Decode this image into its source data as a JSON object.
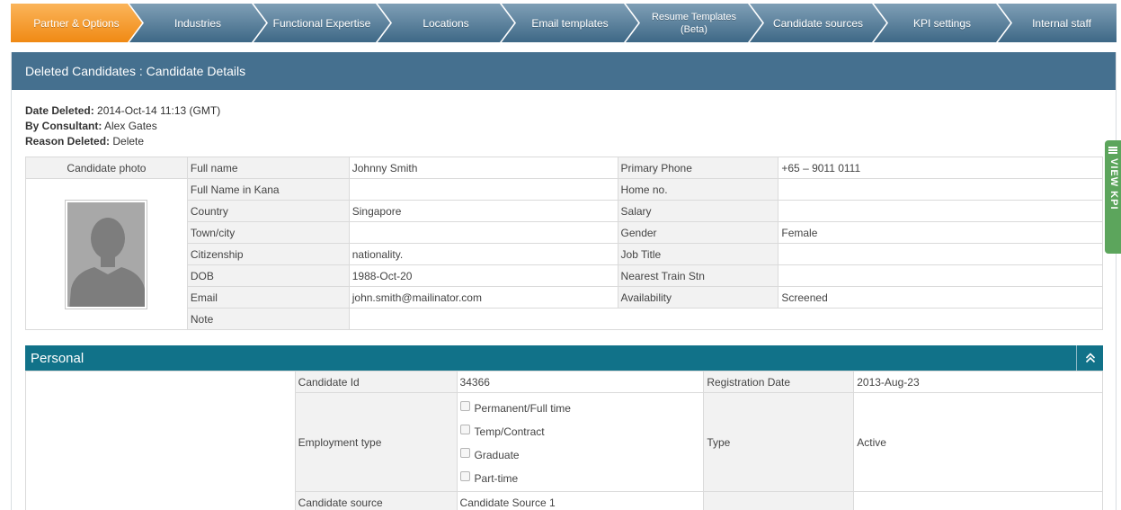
{
  "tabs": [
    {
      "label": "Partner & Options",
      "active": true
    },
    {
      "label": "Industries",
      "active": false
    },
    {
      "label": "Functional Expertise",
      "active": false
    },
    {
      "label": "Locations",
      "active": false
    },
    {
      "label": "Email templates",
      "active": false
    },
    {
      "label": "Resume Templates (Beta)",
      "line1": "Resume Templates",
      "line2": "(Beta)",
      "active": false
    },
    {
      "label": "Candidate sources",
      "active": false
    },
    {
      "label": "KPI settings",
      "active": false
    },
    {
      "label": "Internal staff",
      "active": false
    }
  ],
  "colors": {
    "active_tab": "#f7941e",
    "inactive_tab": "#4e7795",
    "panel_header": "#45708f",
    "section_bar": "#117289",
    "kpi_tab": "#5ca55c"
  },
  "page_title": "Deleted Candidates : Candidate Details",
  "meta": {
    "date_deleted_label": "Date Deleted:",
    "date_deleted_value": "2014-Oct-14 11:13 (GMT)",
    "consultant_label": "By Consultant:",
    "consultant_value": "Alex Gates",
    "reason_label": "Reason Deleted:",
    "reason_value": "Delete"
  },
  "details": {
    "photo_label": "Candidate photo",
    "rows": [
      {
        "l1": "Full name",
        "v1": "Johnny Smith",
        "l2": "Primary Phone",
        "v2": "+65 – 9011 0111"
      },
      {
        "l1": "Full Name in Kana",
        "v1": "",
        "l2": "Home no.",
        "v2": ""
      },
      {
        "l1": "Country",
        "v1": "Singapore",
        "l2": "Salary",
        "v2": ""
      },
      {
        "l1": "Town/city",
        "v1": "",
        "l2": "Gender",
        "v2": "Female"
      },
      {
        "l1": "Citizenship",
        "v1": "nationality.",
        "l2": "Job Title",
        "v2": ""
      },
      {
        "l1": "DOB",
        "v1": "1988-Oct-20",
        "l2": "Nearest Train Stn",
        "v2": ""
      },
      {
        "l1": "Email",
        "v1": "john.smith@mailinator.com",
        "l2": "Availability",
        "v2": "Screened"
      }
    ],
    "note_label": "Note",
    "note_value": ""
  },
  "personal": {
    "title": "Personal",
    "collapse_icon": "double-chevron-up-icon",
    "candidate_id_label": "Candidate Id",
    "candidate_id_value": "34366",
    "registration_date_label": "Registration Date",
    "registration_date_value": "2013-Aug-23",
    "employment_type_label": "Employment type",
    "employment_options": [
      {
        "label": "Permanent/Full time",
        "checked": false
      },
      {
        "label": "Temp/Contract",
        "checked": false
      },
      {
        "label": "Graduate",
        "checked": false
      },
      {
        "label": "Part-time",
        "checked": false
      }
    ],
    "type_label": "Type",
    "type_value": "Active",
    "candidate_source_label": "Candidate source",
    "candidate_source_value": "Candidate Source 1"
  },
  "kpi_tab": {
    "label": "VIEW KPI",
    "icon": "bar-chart-icon"
  }
}
